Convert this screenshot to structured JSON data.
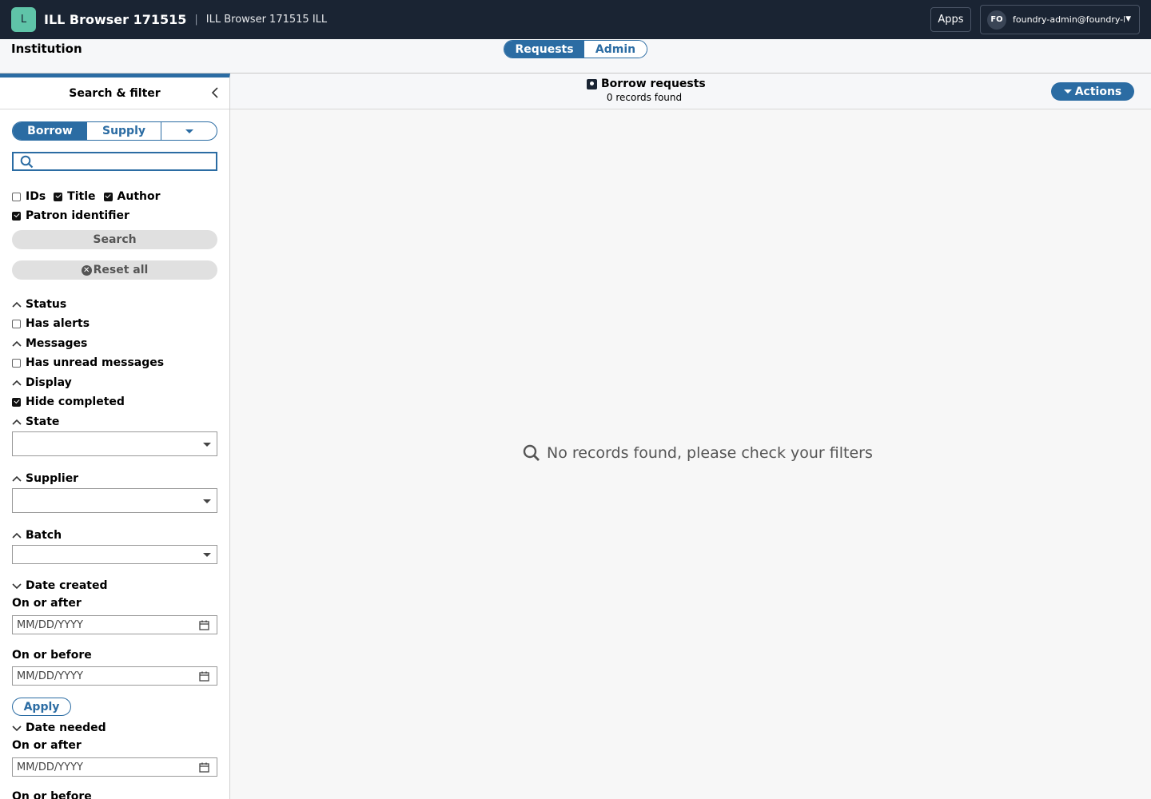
{
  "header": {
    "app_initial": "L",
    "app_title": "ILL Browser 171515",
    "app_subtitle": "ILL Browser 171515  ILL",
    "apps_label": "Apps",
    "user_initials": "FO",
    "user_email": "foundry-admin@foundry-l..."
  },
  "institution": {
    "label": "Institution",
    "tabs": [
      "Requests",
      "Admin"
    ],
    "active_tab": "Requests"
  },
  "sidebar": {
    "title": "Search & filter",
    "mode_tabs": [
      "Borrow",
      "Supply"
    ],
    "active_mode": "Borrow",
    "search_value": "",
    "search_fields": [
      {
        "label": "IDs",
        "checked": false
      },
      {
        "label": "Title",
        "checked": true
      },
      {
        "label": "Author",
        "checked": true
      },
      {
        "label": "Patron identifier",
        "checked": true
      }
    ],
    "search_button": "Search",
    "reset_button": "Reset all",
    "status": {
      "heading": "Status",
      "option": "Has alerts",
      "checked": false
    },
    "messages": {
      "heading": "Messages",
      "option": "Has unread messages",
      "checked": false
    },
    "display": {
      "heading": "Display",
      "option": "Hide completed",
      "checked": true
    },
    "state": {
      "heading": "State"
    },
    "supplier": {
      "heading": "Supplier"
    },
    "batch": {
      "heading": "Batch"
    },
    "date_created": {
      "heading": "Date created",
      "after_label": "On or after",
      "after_placeholder": "MM/DD/YYYY",
      "before_label": "On or before",
      "before_placeholder": "MM/DD/YYYY",
      "apply": "Apply"
    },
    "date_needed": {
      "heading": "Date needed",
      "after_label": "On or after",
      "after_placeholder": "MM/DD/YYYY",
      "before_label": "On or before"
    }
  },
  "main": {
    "title": "Borrow requests",
    "count": "0 records found",
    "actions": "Actions",
    "empty_message": "No records found, please check your filters"
  },
  "colors": {
    "accent": "#2b6ca3",
    "topbar": "#1a2433",
    "app_badge": "#5fc4a8"
  }
}
